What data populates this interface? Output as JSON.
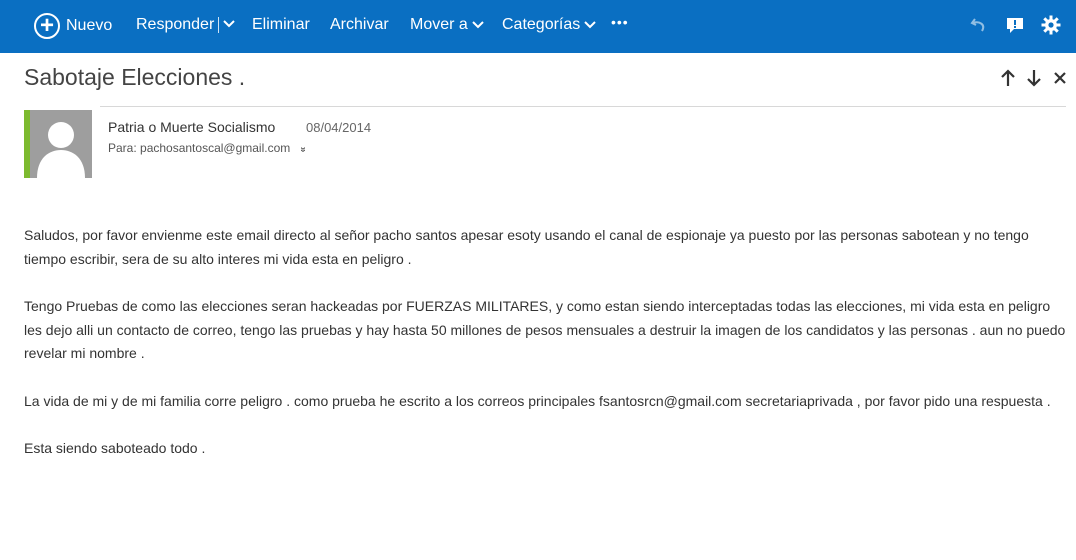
{
  "toolbar": {
    "new_label": "Nuevo",
    "reply_label": "Responder",
    "delete_label": "Eliminar",
    "archive_label": "Archivar",
    "move_label": "Mover a",
    "categories_label": "Categorías",
    "more_label": "•••",
    "bg_color": "#0a6fc2",
    "right_icons": [
      "undo-icon",
      "feedback-icon",
      "settings-gear-icon"
    ]
  },
  "message": {
    "subject": "Sabotaje Elecciones .",
    "sender": "Patria o Muerte Socialismo",
    "date": "08/04/2014",
    "to_line": "Para: pachosantoscal@gmail.com",
    "avatar_accent_color": "#7dba2f",
    "body": [
      "Saludos, por favor envienme este email directo al señor pacho santos apesar esoty usando el canal de espionaje ya puesto por las personas sabotean y no tengo tiempo escribir,  sera de su alto interes mi vida esta en peligro .",
      "Tengo Pruebas de como las elecciones seran hackeadas por FUERZAS MILITARES, y como estan siendo interceptadas todas las elecciones, mi vida esta en peligro les dejo alli un contacto de correo, tengo las pruebas y hay hasta 50 millones de pesos mensuales  a destruir la imagen de los candidatos y las personas . aun no puedo revelar mi nombre .",
      "La vida de mi y de mi familia corre peligro . como prueba he escrito a los correos principales fsantosrcn@gmail.com secretariaprivada , por favor pido una respuesta .",
      "Esta siendo saboteado todo ."
    ]
  }
}
